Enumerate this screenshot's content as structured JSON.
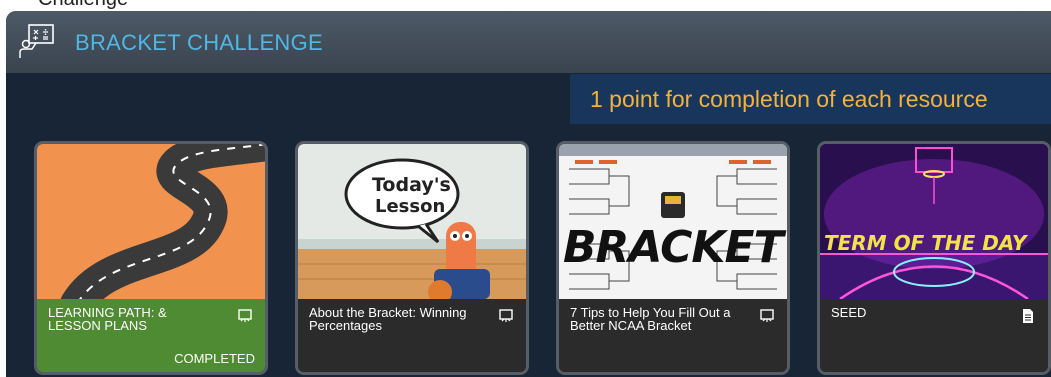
{
  "top_fragment": "Challenge",
  "header": {
    "title": "BRACKET CHALLENGE"
  },
  "banner": {
    "text": "1 point for completion of each resource"
  },
  "cards": [
    {
      "title": "LEARNING PATH: & LESSON PLANS",
      "type_icon": "presentation-icon",
      "status": "COMPLETED"
    },
    {
      "title": "About the Bracket: Winning Percentages",
      "type_icon": "presentation-icon",
      "image_text": [
        "Today's",
        "Lesson"
      ]
    },
    {
      "title": "7 Tips to Help You Fill Out a Better NCAA Bracket",
      "type_icon": "presentation-icon",
      "image_text": [
        "BRACKET"
      ]
    },
    {
      "title": "SEED",
      "type_icon": "document-icon",
      "image_text": [
        "TERM OF THE DAY"
      ]
    }
  ]
}
